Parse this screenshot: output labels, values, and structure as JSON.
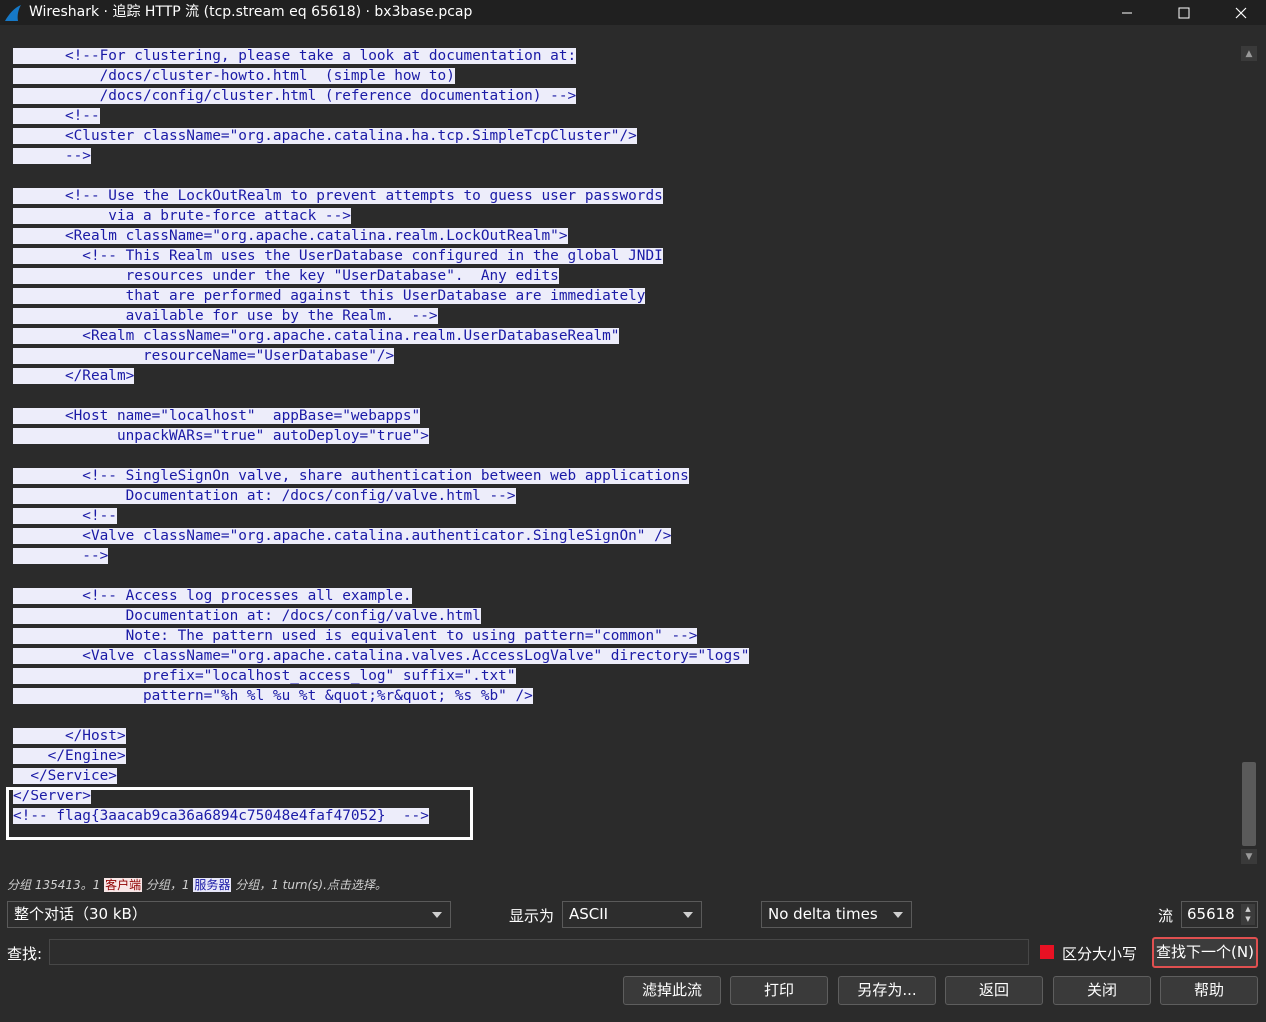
{
  "window": {
    "title": "Wireshark · 追踪 HTTP 流 (tcp.stream eq 65618) · bx3base.pcap"
  },
  "stream": {
    "lines": [
      "      <!--For clustering, please take a look at documentation at:",
      "          /docs/cluster-howto.html  (simple how to)",
      "          /docs/config/cluster.html (reference documentation) -->",
      "      <!--",
      "      <Cluster className=\"org.apache.catalina.ha.tcp.SimpleTcpCluster\"/>",
      "      -->",
      "",
      "      <!-- Use the LockOutRealm to prevent attempts to guess user passwords",
      "           via a brute-force attack -->",
      "      <Realm className=\"org.apache.catalina.realm.LockOutRealm\">",
      "        <!-- This Realm uses the UserDatabase configured in the global JNDI",
      "             resources under the key \"UserDatabase\".  Any edits",
      "             that are performed against this UserDatabase are immediately",
      "             available for use by the Realm.  -->",
      "        <Realm className=\"org.apache.catalina.realm.UserDatabaseRealm\"",
      "               resourceName=\"UserDatabase\"/>",
      "      </Realm>",
      "",
      "      <Host name=\"localhost\"  appBase=\"webapps\"",
      "            unpackWARs=\"true\" autoDeploy=\"true\">",
      "",
      "        <!-- SingleSignOn valve, share authentication between web applications",
      "             Documentation at: /docs/config/valve.html -->",
      "        <!--",
      "        <Valve className=\"org.apache.catalina.authenticator.SingleSignOn\" />",
      "        -->",
      "",
      "        <!-- Access log processes all example.",
      "             Documentation at: /docs/config/valve.html",
      "             Note: The pattern used is equivalent to using pattern=\"common\" -->",
      "        <Valve className=\"org.apache.catalina.valves.AccessLogValve\" directory=\"logs\"",
      "               prefix=\"localhost_access_log\" suffix=\".txt\"",
      "               pattern=\"%h %l %u %t &quot;%r&quot; %s %b\" />",
      "",
      "      </Host>",
      "    </Engine>",
      "  </Service>",
      "</Server>",
      "<!-- flag{3aacab9ca36a6894c75048e4faf47052}  -->"
    ]
  },
  "status": {
    "prefix": "分组 135413。1 ",
    "client_label": "客户端",
    "middle": " 分组，1 ",
    "server_label": "服务器",
    "suffix": " 分组，1 turn(s).点击选择。"
  },
  "controls": {
    "conversation_select": "整个对话（30 kB）",
    "show_as_label": "显示为",
    "show_as_value": "ASCII",
    "delta_select": "No delta times",
    "stream_label": "流",
    "stream_value": "65618"
  },
  "find": {
    "label": "查找:",
    "value": "",
    "case_sensitive_label": "区分大小写",
    "find_next_label": "查找下一个(N)"
  },
  "buttons": {
    "filter_out": "滤掉此流",
    "print": "打印",
    "save_as": "另存为...",
    "back": "返回",
    "close": "关闭",
    "help": "帮助"
  },
  "colors": {
    "client_text": "#8f0000",
    "server_text": "#1a1aa6",
    "server_bg": "#ededfa",
    "highlight_border": "#ffffff",
    "checkbox": "#e81123"
  }
}
